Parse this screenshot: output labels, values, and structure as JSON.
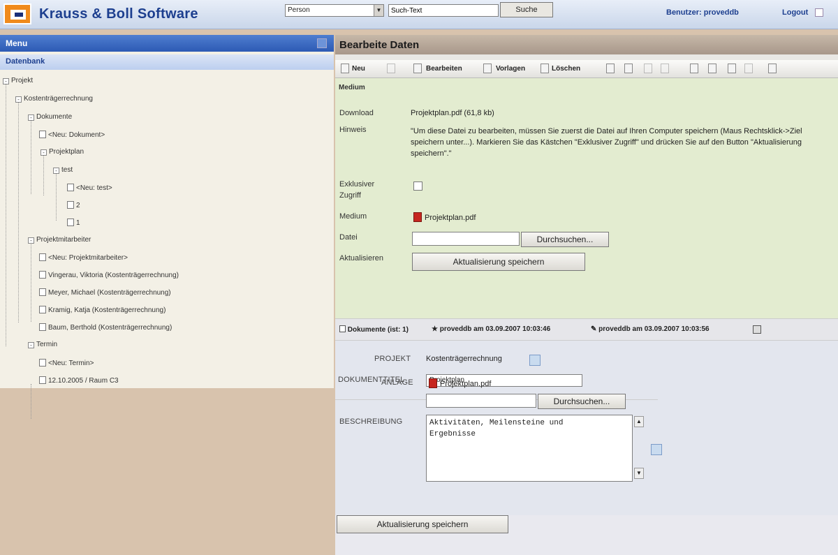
{
  "header": {
    "brand": "Krauss & Boll Software",
    "select_value": "Person",
    "search_value": "Such-Text",
    "search_button": "Suche",
    "user_link": "Benutzer: proveddb",
    "logout_link": "Logout"
  },
  "left": {
    "menu_title": "Menu",
    "section_title": "Datenbank",
    "tree": {
      "projekt": "Projekt",
      "kostentraeger": "Kostenträgerrechnung",
      "dokumente": "Dokumente",
      "neu_dokument": "<Neu: Dokument>",
      "projektplan": "Projektplan",
      "test": "test",
      "neu_test": "<Neu: test>",
      "item_2": "2",
      "item_1": "1",
      "projektmitarbeiter": "Projektmitarbeiter",
      "neu_projektmitarbeiter": "<Neu: Projektmitarbeiter>",
      "person_1": "Vingerau, Viktoria (Kostenträgerrechnung)",
      "person_2": "Meyer, Michael (Kostenträgerrechnung)",
      "person_3": "Kramig, Katja (Kostenträgerrechnung)",
      "person_4": "Baum, Berthold (Kostenträgerrechnung)",
      "termin": "Termin",
      "neu_termin": "<Neu: Termin>",
      "termin_1": "12.10.2005 / Raum C3"
    }
  },
  "right": {
    "title": "Bearbeite Daten",
    "toolbar": {
      "neu": "Neu",
      "bearbeiten": "Bearbeiten",
      "vorlagen": "Vorlagen",
      "loeschen": "Löschen"
    },
    "medium_section": {
      "heading": "Medium",
      "download_label": "Download",
      "download_value": "Projektplan.pdf (61,8 kb)",
      "hinweis_label": "Hinweis",
      "hinweis_text": "\"Um diese Datei zu bearbeiten, müssen Sie zuerst die Datei auf Ihren Computer speichern (Maus Rechtsklick->Ziel speichern unter...). Markieren Sie das Kästchen \"Exklusiver Zugriff\" und drücken Sie auf den Button \"Aktualisierung speichern\".\"",
      "exklusiv_label_1": "Exklusiver",
      "exklusiv_label_2": "Zugriff",
      "medium_label": "Medium",
      "medium_value": "Projektplan.pdf",
      "datei_label": "Datei",
      "browse_button": "Durchsuchen...",
      "aktualisieren_label": "Aktualisieren",
      "save_button": "Aktualisierung speichern"
    },
    "meta": {
      "dokumente": "Dokumente (ist: 1)",
      "erstellt": "proveddb am 03.09.2007 10:03:46",
      "bearbeitet": "proveddb am 03.09.2007 10:03:56"
    },
    "form": {
      "projekt_label": "PROJEKT",
      "projekt_value": "Kostenträgerrechnung",
      "titel_label": "DOKUMENTTITEL",
      "titel_value": "Projektplan",
      "anlage_label": "ANLAGE",
      "anlage_value": "Projektplan.pdf",
      "browse_button": "Durchsuchen...",
      "beschreibung_label": "BESCHREIBUNG",
      "beschreibung_value": "Aktivitäten, Meilensteine und\nErgebnisse",
      "save_button": "Aktualisierung speichern"
    }
  }
}
